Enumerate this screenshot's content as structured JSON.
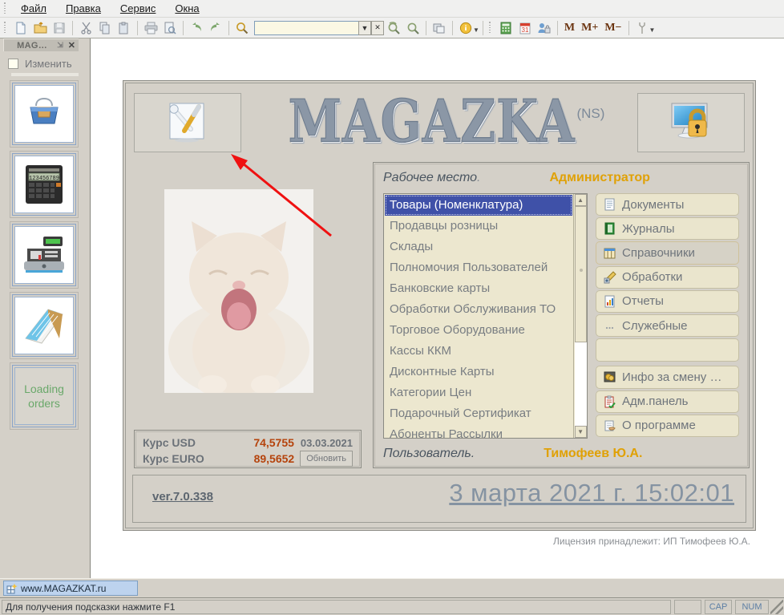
{
  "menubar": {
    "items": [
      {
        "label": "Файл",
        "name": "menu-file"
      },
      {
        "label": "Правка",
        "name": "menu-edit"
      },
      {
        "label": "Сервис",
        "name": "menu-service"
      },
      {
        "label": "Окна",
        "name": "menu-windows"
      }
    ]
  },
  "toolbar": {
    "icons": [
      "new-document-icon",
      "open-folder-icon",
      "save-icon",
      "cut-icon",
      "copy-icon",
      "paste-icon",
      "print-icon",
      "print-preview-icon",
      "undo-icon",
      "redo-icon",
      "search-icon"
    ],
    "search_value": "",
    "dropdown_arrow": "▼",
    "clear_label": "✕",
    "find_again_icon": "find-again-icon",
    "find_prev_icon": "find-previous-icon",
    "windows_icon": "cascade-windows-icon",
    "info_icon": "info-icon",
    "calculator_icon": "calculator-icon",
    "calendar_icon": "calendar-icon",
    "user_icon": "user-lock-icon",
    "m_label": "M",
    "mplus_label": "M+",
    "mminus_label": "M−",
    "wrench_icon": "wrench-icon"
  },
  "leftdock": {
    "tab_title": "MAG…",
    "pin_icon": "pin-icon",
    "close_icon": "close-icon",
    "checkbox_label": "Изменить",
    "buttons": [
      {
        "name": "dock-button-basket",
        "icon": "shopping-basket-icon",
        "label": ""
      },
      {
        "name": "dock-button-calculator",
        "icon": "calculator-icon",
        "label": ""
      },
      {
        "name": "dock-button-cash-register",
        "icon": "cash-register-icon",
        "label": ""
      },
      {
        "name": "dock-button-notepad",
        "icon": "notepad-icon",
        "label": ""
      },
      {
        "name": "dock-button-loading-orders",
        "icon": "",
        "label": "Loading\norders",
        "line1": "Loading",
        "line2": "orders"
      }
    ]
  },
  "panel": {
    "settings_button_icon": "tools-wrench-screwdriver-icon",
    "lock_button_icon": "monitor-lock-icon",
    "logo_text": "MAGAZKA",
    "logo_suffix": "(NS)",
    "workplace_label": "Рабочее место",
    "workplace_dot": ".",
    "workplace_value": "Администратор",
    "user_label": "Пользователь",
    "user_dot": ".",
    "user_value": "Тимофеев Ю.А.",
    "list_items": [
      "Товары (Номенклатура)",
      "Продавцы розницы",
      "Склады",
      "Полномочия Пользователей",
      "Банковские карты",
      "Обработки Обслуживания ТО",
      "Торговое Оборудование",
      "Кассы ККМ",
      "Дисконтные Карты",
      "Категории Цен",
      "Подарочный Сертификат",
      "Абоненты Рассылки"
    ],
    "list_selected_index": 0,
    "scroll_up_glyph": "▲",
    "scroll_down_glyph": "▼",
    "menu_buttons": [
      {
        "label": "Документы",
        "icon": "document-icon",
        "active": false
      },
      {
        "label": "Журналы",
        "icon": "journal-book-icon",
        "active": false
      },
      {
        "label": "Справочники",
        "icon": "catalog-table-icon",
        "active": true
      },
      {
        "label": "Обработки",
        "icon": "processing-icon",
        "active": false
      },
      {
        "label": "Отчеты",
        "icon": "report-chart-icon",
        "active": false
      },
      {
        "label": "Служебные",
        "icon": "ellipsis-icon",
        "active": false
      }
    ],
    "menu_buttons_secondary": [
      {
        "label": "Инфо за смену …",
        "icon": "coins-info-icon",
        "active": false
      },
      {
        "label": "Адм.панель",
        "icon": "clipboard-check-icon",
        "active": false
      },
      {
        "label": "О программе",
        "icon": "about-hand-icon",
        "active": false
      }
    ],
    "rates": [
      {
        "name": "Курс USD",
        "value": "74,5755",
        "extra": "03.03.2021",
        "extra_type": "date"
      },
      {
        "name": "Курс EURO",
        "value": "89,5652",
        "extra": "Обновить",
        "extra_type": "button"
      }
    ],
    "version": "ver.7.0.338",
    "clock": "3 марта 2021 г. 15:02:01",
    "license": "Лицензия принадлежит: ИП Тимофеев Ю.А.",
    "annotation_arrow": "red-arrow-annotation"
  },
  "taskbar": {
    "item_label": "www.MAGAZKAT.ru",
    "item_icon": "app-window-icon"
  },
  "statusbar": {
    "hint": "Для получения подсказки нажмите F1",
    "cells": [
      "",
      "CAP",
      "NUM"
    ]
  },
  "colors": {
    "accent_gold": "#e0a106",
    "selection_blue": "#3f51a8",
    "rate_value": "#b5430c",
    "list_bg": "#ece7cf",
    "menu_button_bg": "#eae5cd",
    "window_bg": "#d4d0c8",
    "arrow_red": "#ef1111"
  }
}
